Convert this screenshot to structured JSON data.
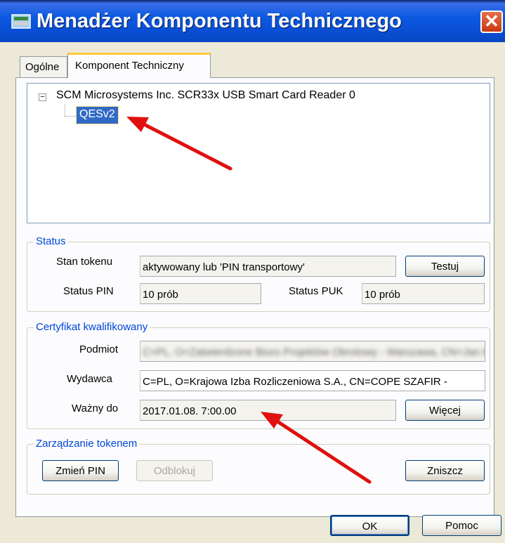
{
  "window": {
    "title": "Menadżer Komponentu Technicznego",
    "close_symbol": "✕"
  },
  "tabs": [
    {
      "label": "Ogólne",
      "active": false
    },
    {
      "label": "Komponent Techniczny",
      "active": true
    }
  ],
  "tree": {
    "root_label": "SCM Microsystems Inc. SCR33x USB Smart Card Reader 0",
    "toggle_symbol": "−",
    "child_label": "QESv2",
    "child_selected": true
  },
  "status_group": {
    "legend": "Status",
    "token_state_label": "Stan tokenu",
    "token_state_value": "aktywowany lub 'PIN transportowy'",
    "test_button": "Testuj",
    "pin_status_label": "Status PIN",
    "pin_status_value": "10 prób",
    "puk_status_label": "Status PUK",
    "puk_status_value": "10 prób"
  },
  "certificate_group": {
    "legend": "Certyfikat kwalifikowany",
    "subject_label": "Podmiot",
    "subject_value": "C=PL, O=Zatwierdzone Biuro Projektów Obrotowy - Warszawa, CN=Jan Kowalski",
    "issuer_label": "Wydawca",
    "issuer_value": "C=PL, O=Krajowa Izba Rozliczeniowa S.A., CN=COPE SZAFIR -",
    "valid_to_label": "Ważny do",
    "valid_to_value": "2017.01.08. 7:00.00",
    "more_button": "Więcej"
  },
  "token_mgmt_group": {
    "legend": "Zarządzanie tokenem",
    "change_pin_button": "Zmień PIN",
    "unblock_button": "Odblokuj",
    "destroy_button": "Zniszcz"
  },
  "footer": {
    "ok_button": "OK",
    "help_button": "Pomoc"
  },
  "colors": {
    "titlebar": "#0a4fd6",
    "selection": "#316ac5",
    "group_legend": "#0046d5",
    "annotation_arrow": "#e01010"
  },
  "annotations": {
    "arrow_count": 2,
    "arrow_targets": [
      "tree-child-item",
      "valid-to-field"
    ]
  }
}
